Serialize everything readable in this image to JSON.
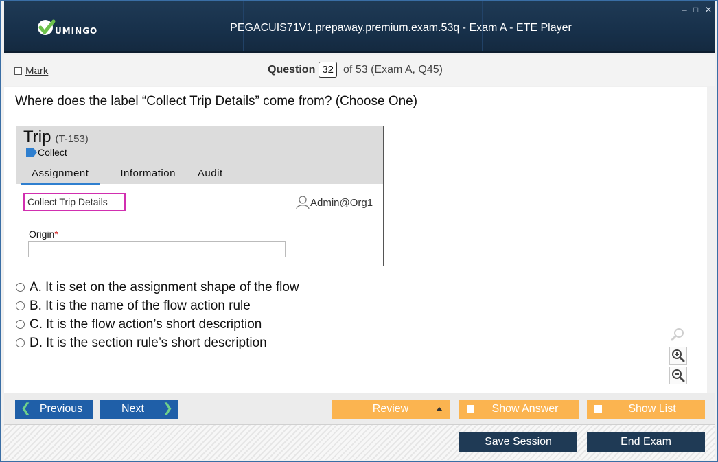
{
  "window": {
    "title": "PEGACUIS71V1.prepaway.premium.exam.53q - Exam A - ETE Player",
    "logo_text": "UMINGO",
    "controls": [
      "–",
      "□",
      "✕"
    ]
  },
  "header": {
    "mark_label": "Mark",
    "question_label": "Question",
    "question_number": "32",
    "question_of": "of 53 (Exam A, Q45)"
  },
  "question": {
    "text": "Where does the label “Collect Trip Details” come from? (Choose One)"
  },
  "figure": {
    "title": "Trip",
    "case_id": "(T-153)",
    "stage": "Collect",
    "tabs": [
      "Assignment",
      "Information",
      "Audit"
    ],
    "label": "Collect Trip Details",
    "user": "Admin@Org1",
    "field_label": "Origin",
    "required_mark": "*"
  },
  "answers": [
    {
      "letter": "A.",
      "text": "It is set on the assignment shape of the flow"
    },
    {
      "letter": "B.",
      "text": "It is the name of the flow action rule"
    },
    {
      "letter": "C.",
      "text": "It is the flow action’s short description"
    },
    {
      "letter": "D.",
      "text": "It is the section rule’s short description"
    }
  ],
  "nav": {
    "previous": "Previous",
    "next": "Next",
    "review": "Review",
    "show_answer": "Show Answer",
    "show_list": "Show List"
  },
  "bottom": {
    "save_session": "Save Session",
    "end_exam": "End Exam"
  },
  "colors": {
    "titlebar": "#17304a",
    "nav_blue": "#1f5fa8",
    "nav_orange": "#fbb450",
    "highlight": "#d12fb0",
    "stage_blue": "#2f7fcf"
  }
}
